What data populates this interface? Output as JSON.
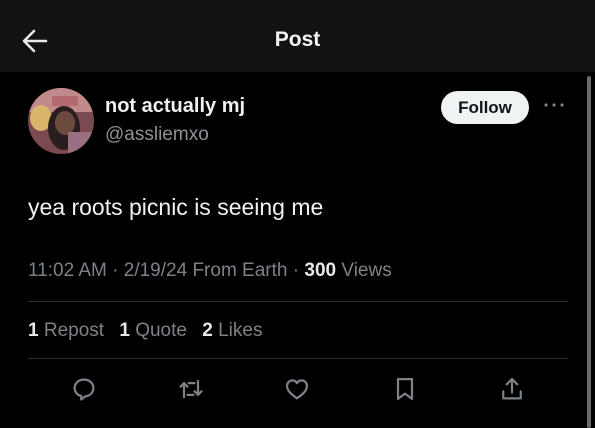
{
  "header": {
    "title": "Post",
    "back_icon": "arrow-left-icon"
  },
  "author": {
    "display_name": "not actually mj",
    "handle": "@assliemxo",
    "follow_label": "Follow",
    "more_icon": "more-horizontal-icon"
  },
  "post": {
    "text": "yea roots picnic is seeing me",
    "time": "11:02 AM",
    "separator": "·",
    "date": "2/19/24",
    "source": "From Earth",
    "views_count": "300",
    "views_label": "Views"
  },
  "stats": {
    "reposts_count": "1",
    "reposts_label": "Repost",
    "quotes_count": "1",
    "quotes_label": "Quote",
    "likes_count": "2",
    "likes_label": "Likes"
  },
  "actions": [
    "reply-icon",
    "repost-icon",
    "like-icon",
    "bookmark-icon",
    "share-icon"
  ],
  "colors": {
    "background": "#000000",
    "header_bg": "#111213",
    "secondary_text": "#7c8288",
    "follow_bg": "#eff3f4"
  }
}
